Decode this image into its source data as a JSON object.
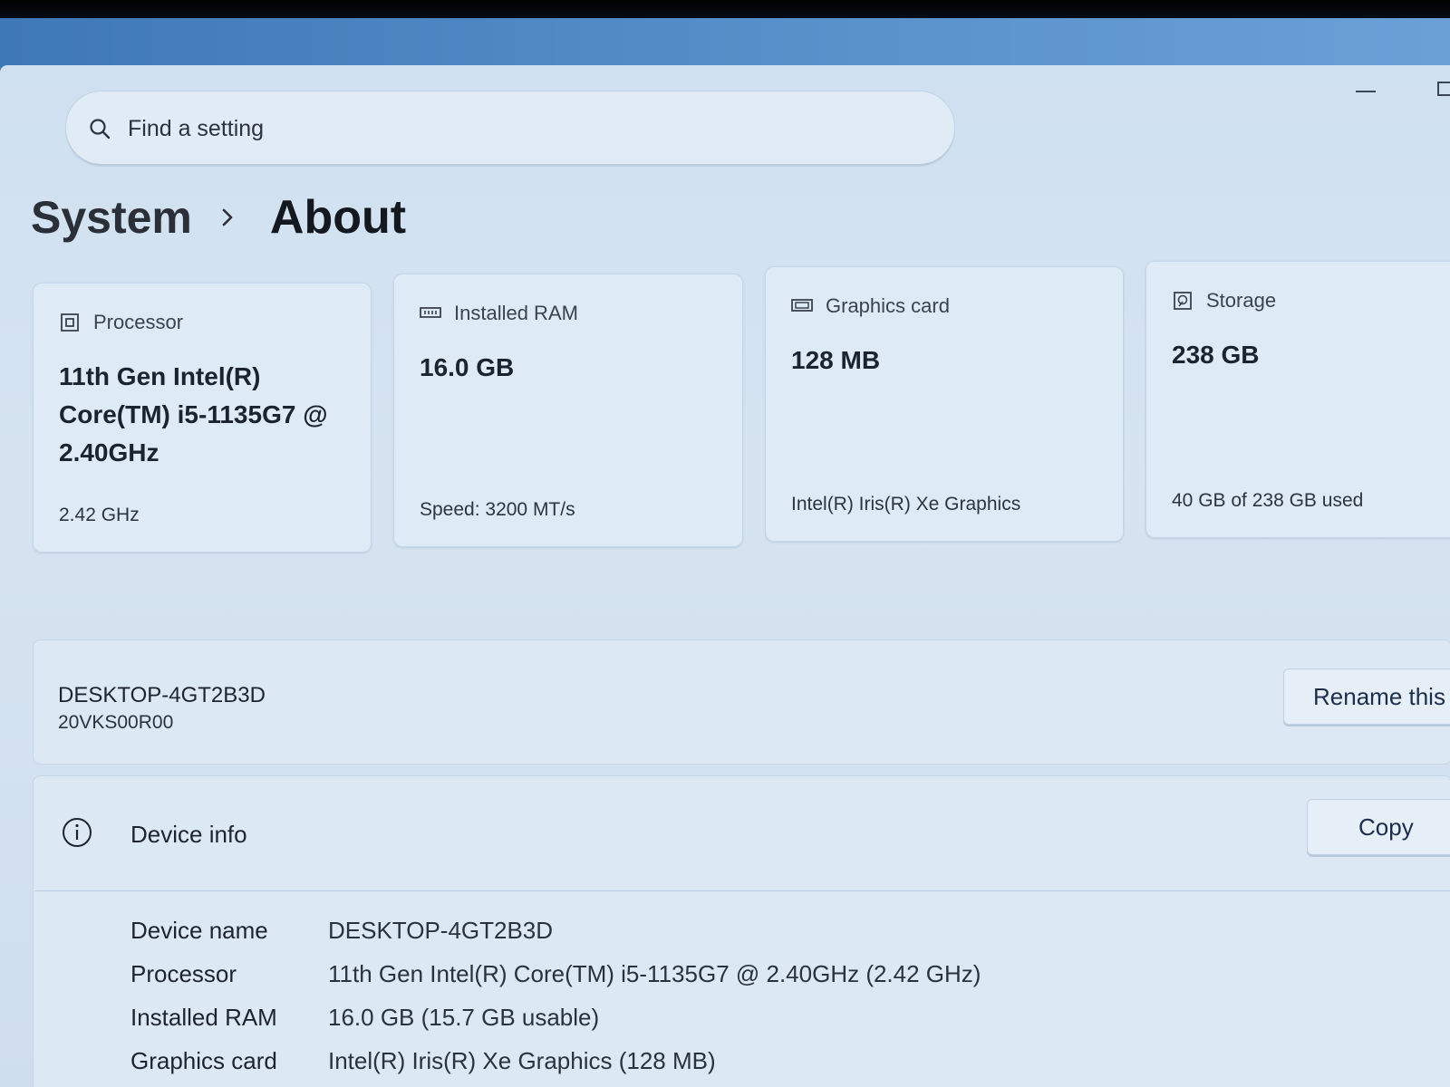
{
  "search": {
    "placeholder": "Find a setting"
  },
  "breadcrumb": {
    "parent": "System",
    "current": "About"
  },
  "cards": [
    {
      "icon": "processor-icon",
      "label": "Processor",
      "value": "11th Gen Intel(R) Core(TM) i5-1135G7 @ 2.40GHz",
      "sub": "2.42 GHz"
    },
    {
      "icon": "ram-icon",
      "label": "Installed RAM",
      "value": "16.0 GB",
      "sub": "Speed: 3200 MT/s"
    },
    {
      "icon": "graphics-card-icon",
      "label": "Graphics card",
      "value": "128 MB",
      "sub": "Intel(R) Iris(R) Xe Graphics"
    },
    {
      "icon": "storage-icon",
      "label": "Storage",
      "value": "238 GB",
      "sub": "40 GB of 238 GB used"
    }
  ],
  "device": {
    "hostname": "DESKTOP-4GT2B3D",
    "model": "20VKS00R00",
    "rename_label": "Rename this"
  },
  "device_info": {
    "title": "Device info",
    "copy_label": "Copy",
    "rows": [
      {
        "label": "Device name",
        "value": "DESKTOP-4GT2B3D"
      },
      {
        "label": "Processor",
        "value": "11th Gen Intel(R) Core(TM) i5-1135G7 @ 2.40GHz (2.42 GHz)"
      },
      {
        "label": "Installed RAM",
        "value": "16.0 GB (15.7 GB usable)"
      },
      {
        "label": "Graphics card",
        "value": "Intel(R) Iris(R) Xe Graphics (128 MB)"
      }
    ]
  }
}
